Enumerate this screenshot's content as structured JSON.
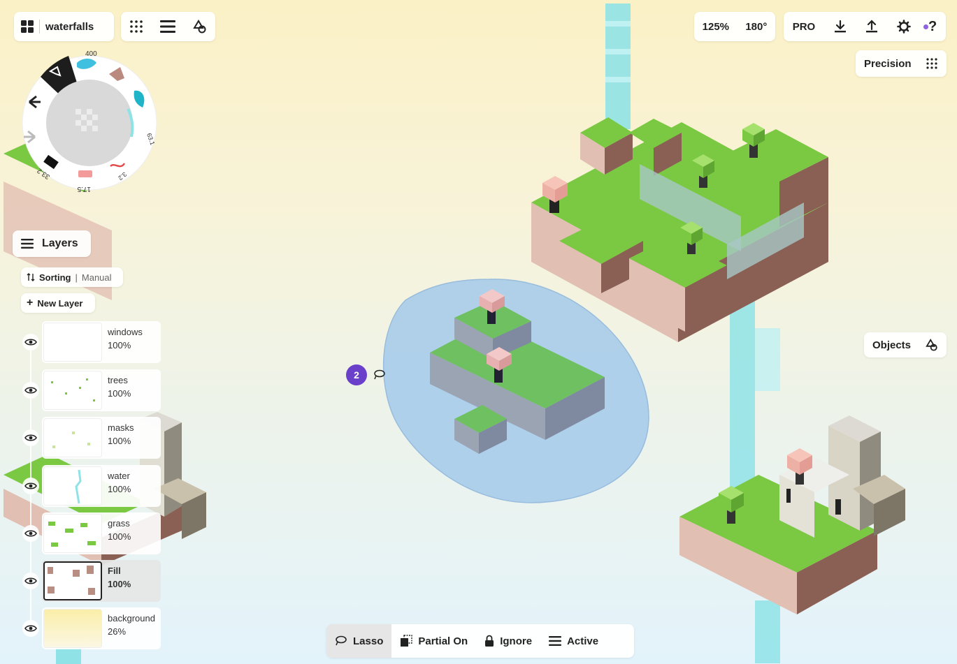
{
  "document": {
    "name": "waterfalls"
  },
  "view": {
    "zoom": "125%",
    "rotation": "180°"
  },
  "mainbar": {
    "pro_label": "PRO",
    "help_label": "?"
  },
  "precision": {
    "label": "Precision"
  },
  "objects": {
    "label": "Objects"
  },
  "wheel": {
    "brush_size_top": "400",
    "value_right": "63.1",
    "value_bottom_right": "3.2",
    "value_bottom": "17.5",
    "value_left": "33.2"
  },
  "layers_panel": {
    "title": "Layers",
    "sorting_label": "Sorting",
    "sorting_value": "Manual",
    "new_layer_label": "New Layer",
    "layers": [
      {
        "name": "windows",
        "opacity": "100%"
      },
      {
        "name": "trees",
        "opacity": "100%"
      },
      {
        "name": "masks",
        "opacity": "100%"
      },
      {
        "name": "water",
        "opacity": "100%"
      },
      {
        "name": "grass",
        "opacity": "100%"
      },
      {
        "name": "Fill",
        "opacity": "100%"
      },
      {
        "name": "background",
        "opacity": "26%"
      }
    ]
  },
  "selection": {
    "count": "2"
  },
  "lasso_bar": {
    "lasso": "Lasso",
    "partial": "Partial On",
    "ignore": "Ignore",
    "active": "Active"
  },
  "colors": {
    "grass": "#7bc843",
    "dirt_pink": "#e2bfb3",
    "dirt_brown": "#8a5f54",
    "water": "#8fe2e6",
    "selection_fill": "#a9cdeb",
    "accent_purple": "#6a3fc9"
  }
}
